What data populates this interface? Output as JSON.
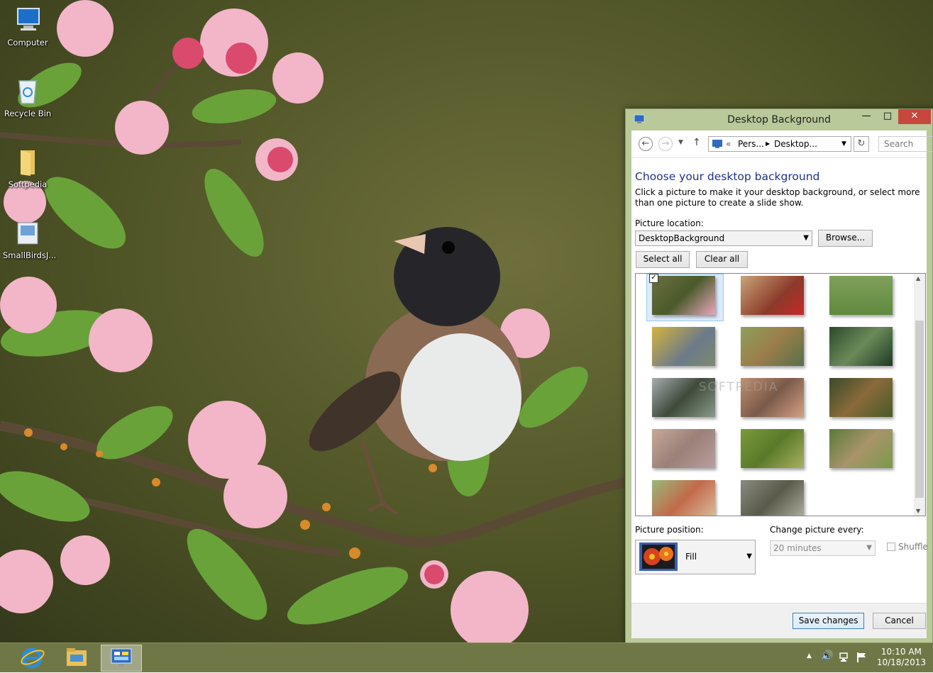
{
  "desktop_icons": [
    {
      "label": "Computer",
      "icon": "computer-icon"
    },
    {
      "label": "Recycle Bin",
      "icon": "recycle-bin-icon"
    },
    {
      "label": "Softpedia",
      "icon": "folder-icon"
    },
    {
      "label": "SmallBirdsJ...",
      "icon": "theme-file-icon"
    }
  ],
  "window": {
    "title": "Desktop Background",
    "nav": {
      "breadcrumb_prefix": "«",
      "crumb1": "Pers...",
      "crumb2": "Desktop...",
      "search_placeholder": "Search Co..."
    },
    "heading": "Choose your desktop background",
    "description": "Click a picture to make it your desktop background, or select more than one picture to create a slide show.",
    "picture_location_label": "Picture location:",
    "picture_location_value": "DesktopBackground",
    "browse": "Browse...",
    "select_all": "Select all",
    "clear_all": "Clear all",
    "picture_position_label": "Picture position:",
    "picture_position_value": "Fill",
    "change_every_label": "Change picture every:",
    "change_every_value": "20 minutes",
    "shuffle": "Shuffle",
    "save": "Save changes",
    "cancel": "Cancel",
    "watermark": "SOFTPEDIA"
  },
  "taskbar": {
    "time": "10:10 AM",
    "date": "10/18/2013"
  }
}
